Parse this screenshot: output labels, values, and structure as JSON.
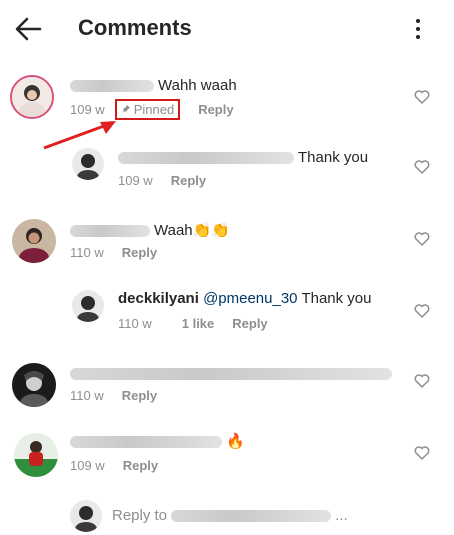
{
  "header": {
    "title": "Comments"
  },
  "comments": [
    {
      "text": "Wahh waah",
      "time": "109 w",
      "pinned_label": "Pinned",
      "reply_label": "Reply"
    },
    {
      "text": "Thank you",
      "time": "109 w",
      "reply_label": "Reply"
    },
    {
      "text": "Waah👏👏",
      "time": "110 w",
      "reply_label": "Reply"
    },
    {
      "username": "deckkilyani",
      "mention": "@pmeenu_30",
      "text": "Thank you",
      "time": "110 w",
      "likes": "1 like",
      "reply_label": "Reply"
    },
    {
      "time": "110 w",
      "reply_label": "Reply"
    },
    {
      "text": "🔥",
      "time": "109 w",
      "reply_label": "Reply"
    }
  ],
  "reply_bar": {
    "placeholder": "Reply to",
    "ellipsis": "..."
  }
}
